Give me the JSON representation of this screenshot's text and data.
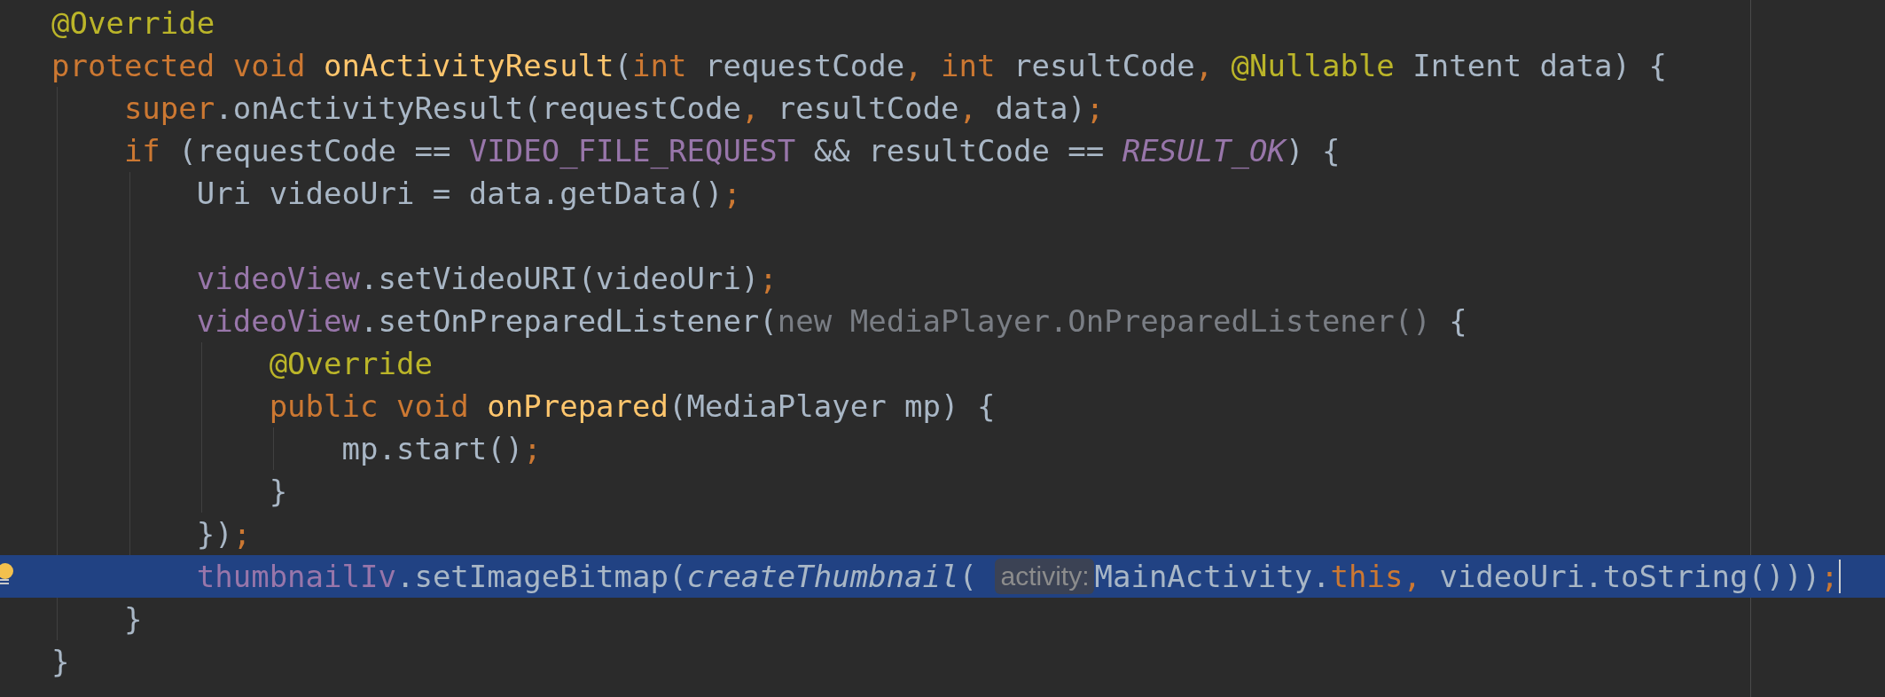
{
  "editor": {
    "lines": [
      {
        "current": false,
        "tokens": [
          {
            "kind": "ann",
            "text": "@Override"
          }
        ]
      },
      {
        "current": false,
        "tokens": [
          {
            "kind": "kw",
            "text": "protected void "
          },
          {
            "kind": "decl",
            "text": "onActivityResult"
          },
          {
            "kind": "plain",
            "text": "("
          },
          {
            "kind": "kw",
            "text": "int "
          },
          {
            "kind": "plain",
            "text": "requestCode"
          },
          {
            "kind": "kw",
            "text": ", int "
          },
          {
            "kind": "plain",
            "text": "resultCode"
          },
          {
            "kind": "kw",
            "text": ", "
          },
          {
            "kind": "ann",
            "text": "@Nullable "
          },
          {
            "kind": "plain",
            "text": "Intent data) {"
          }
        ]
      },
      {
        "current": false,
        "tokens": [
          {
            "kind": "kw",
            "text": "    super"
          },
          {
            "kind": "plain",
            "text": ".onActivityResult(requestCode"
          },
          {
            "kind": "kw",
            "text": ", "
          },
          {
            "kind": "plain",
            "text": "resultCode"
          },
          {
            "kind": "kw",
            "text": ", "
          },
          {
            "kind": "plain",
            "text": "data)"
          },
          {
            "kind": "kw",
            "text": ";"
          }
        ]
      },
      {
        "current": false,
        "tokens": [
          {
            "kind": "kw",
            "text": "    if "
          },
          {
            "kind": "plain",
            "text": "(requestCode == "
          },
          {
            "kind": "field",
            "text": "VIDEO_FILE_REQUEST"
          },
          {
            "kind": "plain",
            "text": " && resultCode == "
          },
          {
            "kind": "static",
            "text": "RESULT_OK"
          },
          {
            "kind": "plain",
            "text": ") {"
          }
        ]
      },
      {
        "current": false,
        "tokens": [
          {
            "kind": "plain",
            "text": "        Uri videoUri = data.getData()"
          },
          {
            "kind": "kw",
            "text": ";"
          }
        ]
      },
      {
        "current": false
      },
      {
        "current": false,
        "tokens": [
          {
            "kind": "field",
            "text": "        videoView"
          },
          {
            "kind": "plain",
            "text": ".setVideoURI(videoUri)"
          },
          {
            "kind": "kw",
            "text": ";"
          }
        ]
      },
      {
        "current": false,
        "tokens": [
          {
            "kind": "field",
            "text": "        videoView"
          },
          {
            "kind": "plain",
            "text": ".setOnPreparedListener("
          },
          {
            "kind": "folded",
            "text": "new MediaPlayer.OnPreparedListener()"
          },
          {
            "kind": "plain",
            "text": " {"
          }
        ]
      },
      {
        "current": false,
        "tokens": [
          {
            "kind": "ann",
            "text": "            @Override"
          }
        ]
      },
      {
        "current": false,
        "tokens": [
          {
            "kind": "kw",
            "text": "            public void "
          },
          {
            "kind": "decl",
            "text": "onPrepared"
          },
          {
            "kind": "plain",
            "text": "(MediaPlayer mp) {"
          }
        ]
      },
      {
        "current": false,
        "tokens": [
          {
            "kind": "plain",
            "text": "                mp.start()"
          },
          {
            "kind": "kw",
            "text": ";"
          }
        ]
      },
      {
        "current": false,
        "tokens": [
          {
            "kind": "plain",
            "text": "            }"
          }
        ]
      },
      {
        "current": false,
        "tokens": [
          {
            "kind": "plain",
            "text": "        })"
          },
          {
            "kind": "kw",
            "text": ";"
          }
        ]
      },
      {
        "current": true,
        "tokens": [
          {
            "kind": "field",
            "text": "        thumbnailIv"
          },
          {
            "kind": "plain",
            "text": ".setImageBitmap("
          },
          {
            "kind": "italic",
            "text": "createThumbnail"
          },
          {
            "kind": "plain",
            "text": "( "
          },
          {
            "kind": "hint",
            "text": "activity:"
          },
          {
            "kind": "plain",
            "text": "MainActivity."
          },
          {
            "kind": "kw",
            "text": "this, "
          },
          {
            "kind": "plain",
            "text": "videoUri.toString()))"
          },
          {
            "kind": "kw",
            "text": ";"
          }
        ]
      },
      {
        "current": false,
        "tokens": [
          {
            "kind": "plain",
            "text": "    }"
          }
        ]
      },
      {
        "current": false,
        "tokens": [
          {
            "kind": "plain",
            "text": "}"
          }
        ]
      }
    ]
  }
}
